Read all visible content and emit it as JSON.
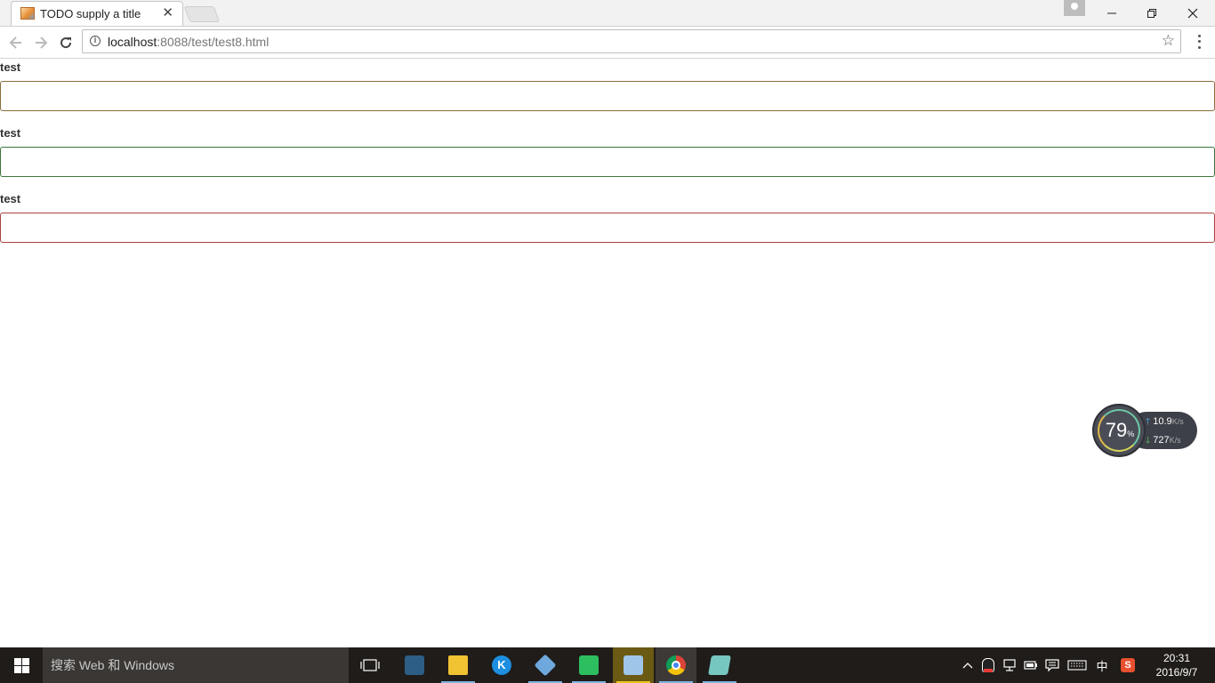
{
  "browser": {
    "tab_title": "TODO supply a title",
    "tab_close": "✕",
    "url_host": "localhost",
    "url_rest": ":8088/test/test8.html",
    "window_controls": {
      "minimize": "—",
      "restore": "❐",
      "close": "✕"
    }
  },
  "form": {
    "fields": [
      {
        "label": "test",
        "value": "",
        "border_color": "#8a6d3b"
      },
      {
        "label": "test",
        "value": "",
        "border_color": "#3c763d"
      },
      {
        "label": "test",
        "value": "",
        "border_color": "#a94442"
      }
    ]
  },
  "net_widget": {
    "percent": "79",
    "percent_sign": "%",
    "upload": "10.9",
    "download": "727",
    "unit": "K/s"
  },
  "taskbar": {
    "search_placeholder": "搜索 Web 和 Windows",
    "ime": "中",
    "time": "20:31",
    "date": "2016/9/7",
    "apps": [
      "task-view",
      "mysql-workbench",
      "file-explorer",
      "kuaibo",
      "virtualbox",
      "evernote",
      "media-player",
      "chrome",
      "notepad"
    ]
  }
}
